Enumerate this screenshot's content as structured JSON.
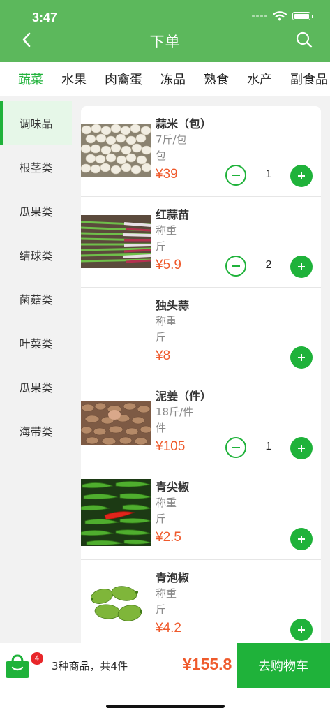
{
  "status": {
    "time": "3:47"
  },
  "nav": {
    "title": "下单",
    "back_icon": "chevron-left-icon",
    "search_icon": "search-icon"
  },
  "categories": [
    "蔬菜",
    "水果",
    "肉禽蛋",
    "冻品",
    "熟食",
    "水产",
    "副食品"
  ],
  "active_category": 0,
  "sidebar": [
    "调味品",
    "根茎类",
    "瓜果类",
    "结球类",
    "菌菇类",
    "叶菜类",
    "瓜果类",
    "海带类"
  ],
  "active_sidebar": 0,
  "products": [
    {
      "name": "蒜米（包）",
      "spec1": "7斤/包",
      "spec2": "包",
      "price": "¥39",
      "qty": "1",
      "image": "garlic-cloves"
    },
    {
      "name": "红蒜苗",
      "spec1": "称重",
      "spec2": "斤",
      "price": "¥5.9",
      "qty": "2",
      "image": "red-garlic-sprouts"
    },
    {
      "name": "独头蒜",
      "spec1": "称重",
      "spec2": "斤",
      "price": "¥8",
      "qty": "",
      "image": ""
    },
    {
      "name": "泥姜（件）",
      "spec1": "18斤/件",
      "spec2": "件",
      "price": "¥105",
      "qty": "1",
      "image": "ginger"
    },
    {
      "name": "青尖椒",
      "spec1": "称重",
      "spec2": "斤",
      "price": "¥2.5",
      "qty": "",
      "image": "green-chili"
    },
    {
      "name": "青泡椒",
      "spec1": "称重",
      "spec2": "斤",
      "price": "¥4.2",
      "qty": "",
      "image": "green-peppers"
    }
  ],
  "cart": {
    "badge": "4",
    "summary": "3种商品，共4件",
    "total": "¥155.8",
    "checkout_label": "去购物车",
    "icon": "shopping-bag-icon"
  },
  "colors": {
    "header": "#5cb85c",
    "accent": "#1fb23a",
    "price": "#ef5a2c",
    "badge": "#e8262a"
  }
}
